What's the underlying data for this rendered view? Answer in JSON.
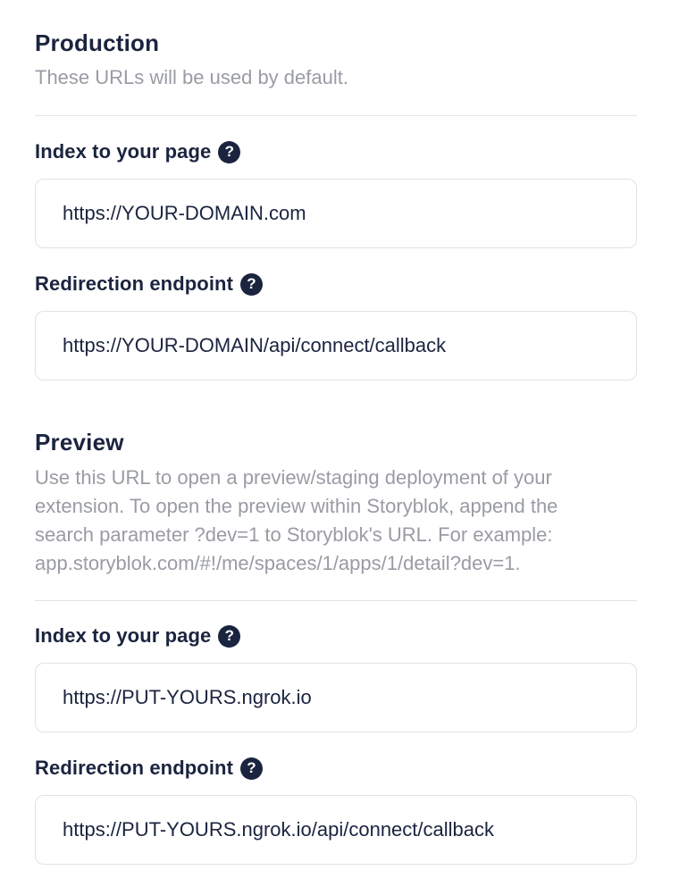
{
  "production": {
    "title": "Production",
    "description": "These URLs will be used by default.",
    "index_field": {
      "label": "Index to your page",
      "help_glyph": "?",
      "value": "https://YOUR-DOMAIN.com"
    },
    "redirect_field": {
      "label": "Redirection endpoint",
      "help_glyph": "?",
      "value": "https://YOUR-DOMAIN/api/connect/callback"
    }
  },
  "preview": {
    "title": "Preview",
    "description_lines": [
      "Use this URL to open a preview/staging deployment of your",
      "extension. To open the preview within Storyblok, append the",
      "search parameter ?dev=1 to Storyblok's URL. For example:",
      "app.storyblok.com/#!/me/spaces/1/apps/1/detail?dev=1."
    ],
    "index_field": {
      "label": "Index to your page",
      "help_glyph": "?",
      "value": "https://PUT-YOURS.ngrok.io"
    },
    "redirect_field": {
      "label": "Redirection endpoint",
      "help_glyph": "?",
      "value": "https://PUT-YOURS.ngrok.io/api/connect/callback"
    }
  },
  "icons": {
    "help": "question-circle-icon"
  },
  "colors": {
    "text_primary": "#1b243f",
    "text_muted": "#9a9ca4",
    "border": "#dfe1e6",
    "divider": "#e2e3e7"
  }
}
